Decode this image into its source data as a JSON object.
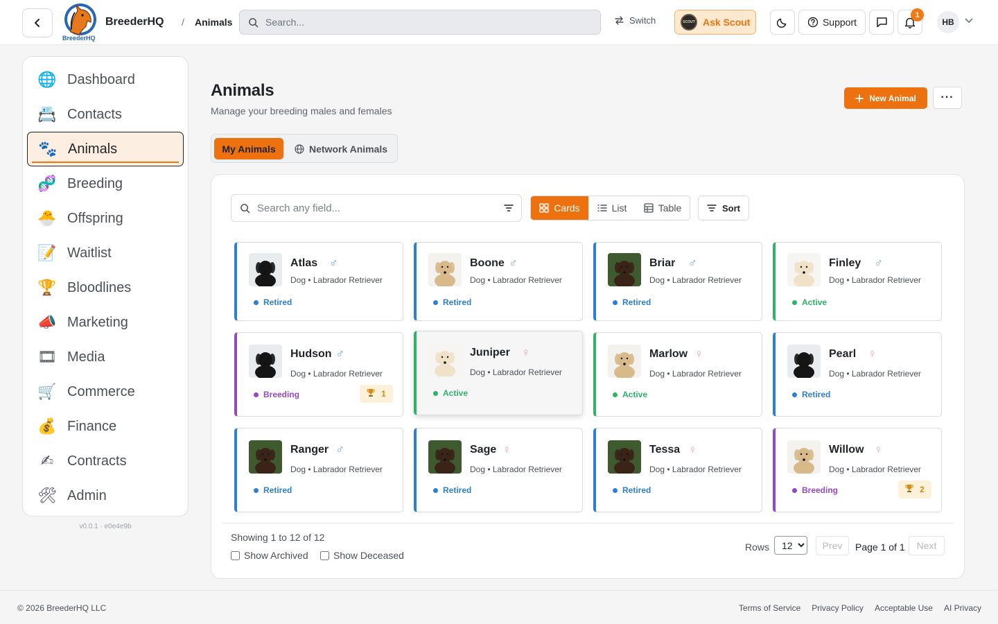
{
  "header": {
    "brand": "BreederHQ",
    "logo_text": "BreederHQ",
    "breadcrumb_sep": "/",
    "breadcrumb": "Animals",
    "search_placeholder": "Search...",
    "switch_label": "Switch",
    "scout_label": "Ask Scout",
    "scout_badge": "SCOUT",
    "support_label": "Support",
    "notification_count": "1",
    "avatar_initials": "HB"
  },
  "sidebar": {
    "items": [
      {
        "label": "Dashboard",
        "icon": "🌐"
      },
      {
        "label": "Contacts",
        "icon": "📇"
      },
      {
        "label": "Animals",
        "icon": "🐾"
      },
      {
        "label": "Breeding",
        "icon": "🧬"
      },
      {
        "label": "Offspring",
        "icon": "🐣"
      },
      {
        "label": "Waitlist",
        "icon": "📝"
      },
      {
        "label": "Bloodlines",
        "icon": "🏆"
      },
      {
        "label": "Marketing",
        "icon": "📣"
      },
      {
        "label": "Media",
        "icon": "🎞"
      },
      {
        "label": "Commerce",
        "icon": "🛒"
      },
      {
        "label": "Finance",
        "icon": "💰"
      },
      {
        "label": "Contracts",
        "icon": "✍"
      },
      {
        "label": "Admin",
        "icon": "🛠"
      }
    ],
    "active_index": 2,
    "version": "v0.0.1 · e0e4e9b"
  },
  "main": {
    "title": "Animals",
    "subtitle": "Manage your breeding males and females",
    "new_button": "New Animal",
    "more_button": "···",
    "tabs": {
      "my": "My Animals",
      "network": "Network Animals"
    },
    "field_search_placeholder": "Search any field...",
    "views": [
      "Cards",
      "List",
      "Table"
    ],
    "sort_label": "Sort"
  },
  "colors": {
    "accent": "#ee7110",
    "retired": "#2f7fd1",
    "active": "#2fb36a",
    "breeding": "#9448c8"
  },
  "animals": [
    {
      "name": "Atlas",
      "sex": "♂",
      "breed": "Dog • Labrador Retriever",
      "status": "Retired",
      "award": "",
      "fur": "black"
    },
    {
      "name": "Boone",
      "sex": "♂",
      "breed": "Dog • Labrador Retriever",
      "status": "Retired",
      "award": "",
      "fur": "yellow"
    },
    {
      "name": "Briar",
      "sex": "♂",
      "breed": "Dog • Labrador Retriever",
      "status": "Retired",
      "award": "",
      "fur": "chocolate"
    },
    {
      "name": "Finley",
      "sex": "♂",
      "breed": "Dog • Labrador Retriever",
      "status": "Active",
      "award": "",
      "fur": "cream"
    },
    {
      "name": "Hudson",
      "sex": "♂",
      "breed": "Dog • Labrador Retriever",
      "status": "Breeding",
      "award": "1",
      "fur": "black"
    },
    {
      "name": "Juniper",
      "sex": "♀",
      "breed": "Dog • Labrador Retriever",
      "status": "Active",
      "award": "",
      "fur": "cream"
    },
    {
      "name": "Marlow",
      "sex": "♀",
      "breed": "Dog • Labrador Retriever",
      "status": "Active",
      "award": "",
      "fur": "yellow"
    },
    {
      "name": "Pearl",
      "sex": "♀",
      "breed": "Dog • Labrador Retriever",
      "status": "Retired",
      "award": "",
      "fur": "black"
    },
    {
      "name": "Ranger",
      "sex": "♂",
      "breed": "Dog • Labrador Retriever",
      "status": "Retired",
      "award": "",
      "fur": "chocolate"
    },
    {
      "name": "Sage",
      "sex": "♀",
      "breed": "Dog • Labrador Retriever",
      "status": "Retired",
      "award": "",
      "fur": "chocolate"
    },
    {
      "name": "Tessa",
      "sex": "♀",
      "breed": "Dog • Labrador Retriever",
      "status": "Retired",
      "award": "",
      "fur": "chocolate"
    },
    {
      "name": "Willow",
      "sex": "♀",
      "breed": "Dog • Labrador Retriever",
      "status": "Breeding",
      "award": "2",
      "fur": "yellow"
    }
  ],
  "pagination": {
    "showing": "Showing 1 to 12 of 12",
    "show_archived": "Show Archived",
    "show_deceased": "Show Deceased",
    "rows_label": "Rows",
    "rows_value": "12",
    "prev": "Prev",
    "page_text": "Page 1 of 1",
    "next": "Next"
  },
  "footer": {
    "copyright": "© 2026 BreederHQ LLC",
    "links": [
      "Terms of Service",
      "Privacy Policy",
      "Acceptable Use",
      "AI Privacy"
    ]
  }
}
